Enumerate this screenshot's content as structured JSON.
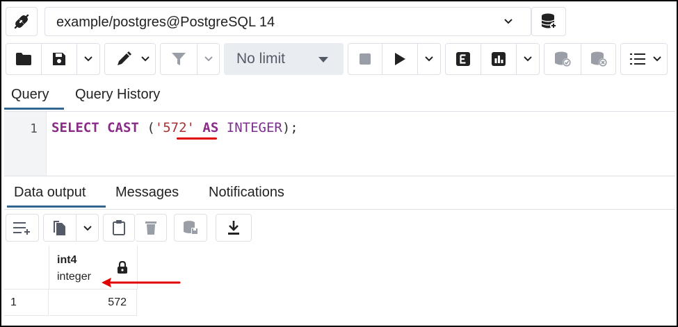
{
  "connection": {
    "label": "example/postgres@PostgreSQL 14"
  },
  "toolbar": {
    "limit_label": "No limit",
    "icons": [
      "folder-icon",
      "save-icon",
      "chevron-down-icon",
      "pen-icon",
      "chevron-down-icon",
      "filter-icon",
      "chevron-down-icon",
      "caret-down-icon",
      "stop-icon",
      "play-icon",
      "chevron-down-icon",
      "explain-icon",
      "explain-analyze-icon",
      "chevron-down-icon",
      "commit-icon",
      "rollback-icon",
      "macros-icon",
      "chevron-down-icon"
    ]
  },
  "query_tabs": [
    {
      "label": "Query",
      "active": true
    },
    {
      "label": "Query History",
      "active": false
    }
  ],
  "editor": {
    "line_number": "1",
    "tokens": {
      "select": "SELECT",
      "cast": "CAST",
      "open": "(",
      "literal": "'572'",
      "as": "AS",
      "type": "INTEGER",
      "close": ");"
    }
  },
  "output_tabs": [
    {
      "label": "Data output",
      "active": true
    },
    {
      "label": "Messages",
      "active": false
    },
    {
      "label": "Notifications",
      "active": false
    }
  ],
  "output_toolbar": {
    "icons": [
      "add-row-icon",
      "copy-icon",
      "chevron-down-icon",
      "paste-icon",
      "delete-icon",
      "save-data-icon",
      "download-icon"
    ]
  },
  "grid": {
    "column": {
      "name": "int4",
      "type": "integer",
      "icon": "lock-icon"
    },
    "rows": [
      {
        "num": "1",
        "value": "572"
      }
    ]
  },
  "colors": {
    "accent": "#326690",
    "keyword": "#8b2b88",
    "string": "#a83232",
    "annotation": "#e00000"
  }
}
